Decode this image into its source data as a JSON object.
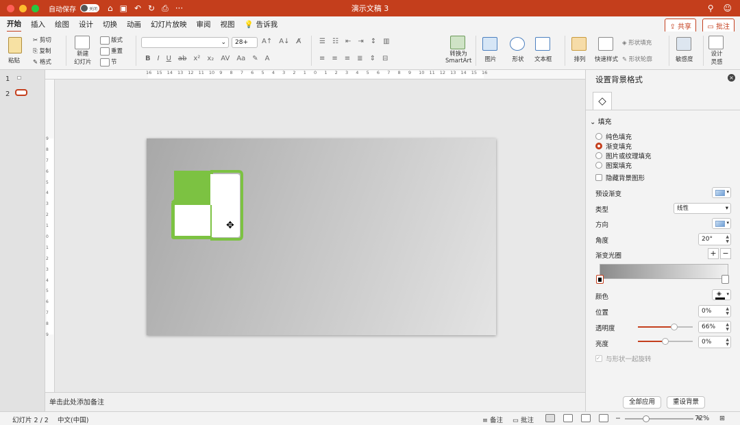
{
  "titlebar": {
    "autosave_label": "自动保存",
    "autosave_state": "关闭",
    "doc_title": "演示文稿 3"
  },
  "tabs": {
    "items": [
      "开始",
      "插入",
      "绘图",
      "设计",
      "切换",
      "动画",
      "幻灯片放映",
      "审阅",
      "视图"
    ],
    "tell_me": "告诉我",
    "share": "共享",
    "comments": "批注"
  },
  "ribbon": {
    "paste": "粘贴",
    "cut": "剪切",
    "copy": "复制",
    "format": "格式",
    "new_slide_line1": "新建",
    "new_slide_line2": "幻灯片",
    "layout": "版式",
    "reset": "重置",
    "section": "节",
    "font_size": "28+",
    "convert_line1": "转换为",
    "convert_line2": "SmartArt",
    "picture": "图片",
    "shape": "形状",
    "textbox": "文本框",
    "arrange": "排列",
    "quick_styles": "快速样式",
    "shape_fill": "形状填充",
    "shape_outline": "形状轮廓",
    "sensitivity": "敏感度",
    "designer_line1": "设计",
    "designer_line2": "灵感"
  },
  "thumbnails": [
    {
      "num": "1"
    },
    {
      "num": "2"
    }
  ],
  "ruler": {
    "h_labels": [
      "16",
      "15",
      "14",
      "13",
      "12",
      "11",
      "10",
      "9",
      "8",
      "7",
      "6",
      "5",
      "4",
      "3",
      "2",
      "1",
      "0",
      "1",
      "2",
      "3",
      "4",
      "5",
      "6",
      "7",
      "8",
      "9",
      "10",
      "11",
      "12",
      "13",
      "14",
      "15",
      "16"
    ],
    "v_labels": [
      "9",
      "8",
      "7",
      "6",
      "5",
      "4",
      "3",
      "2",
      "1",
      "0",
      "1",
      "2",
      "3",
      "4",
      "5",
      "6",
      "7",
      "8",
      "9"
    ]
  },
  "notes": {
    "placeholder": "单击此处添加备注"
  },
  "pane": {
    "title": "设置背景格式",
    "fill_section": "填充",
    "radios": [
      {
        "label": "纯色填充",
        "selected": false
      },
      {
        "label": "渐变填充",
        "selected": true
      },
      {
        "label": "图片或纹理填充",
        "selected": false
      },
      {
        "label": "图案填充",
        "selected": false
      }
    ],
    "hide_bg": "隐藏背景图形",
    "preset_label": "预设渐变",
    "type_label": "类型",
    "type_value": "线性",
    "direction_label": "方向",
    "angle_label": "角度",
    "angle_value": "20°",
    "stops_label": "渐变光圈",
    "color_label": "颜色",
    "position_label": "位置",
    "position_value": "0%",
    "transparency_label": "透明度",
    "transparency_value": "66%",
    "transparency_level": 0.66,
    "brightness_label": "亮度",
    "brightness_value": "0%",
    "brightness_level": 0.5,
    "rotate_with_shape": "与形状一起旋转",
    "apply_all": "全部应用",
    "reset_bg": "重设背景"
  },
  "statusbar": {
    "slide_info": "幻灯片 2 / 2",
    "language": "中文(中国)",
    "notes": "备注",
    "comments": "批注",
    "zoom": "72%"
  },
  "colors": {
    "accent": "#c43e1c",
    "shape_green": "#7cc242"
  }
}
